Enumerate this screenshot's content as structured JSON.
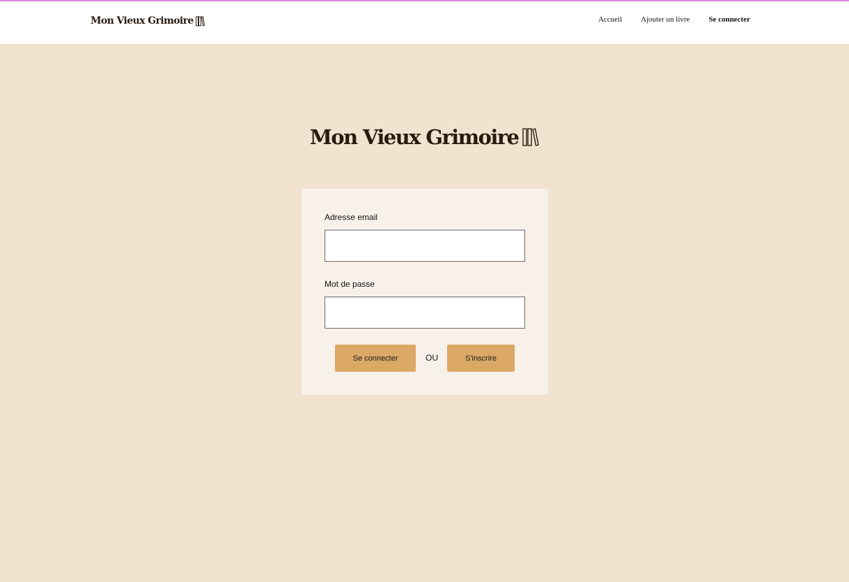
{
  "header": {
    "brand": "Mon Vieux Grimoire",
    "brand_icon": "books-icon",
    "nav": [
      {
        "label": "Accueil"
      },
      {
        "label": "Ajouter un livre"
      },
      {
        "label": "Se connecter",
        "active": true
      }
    ]
  },
  "hero": {
    "title": "Mon Vieux Grimoire",
    "icon": "books-icon"
  },
  "login_form": {
    "email_label": "Adresse email",
    "email_value": "",
    "email_placeholder": "",
    "password_label": "Mot de passe",
    "password_value": "",
    "password_placeholder": "",
    "login_button": "Se connecter",
    "separator": "OU",
    "signup_button": "S'inscrire"
  },
  "colors": {
    "page_background": "#f1e3cf",
    "card_background": "#f8f1ea",
    "button": "#dba865",
    "top_accent_line": "#d98ad8"
  }
}
